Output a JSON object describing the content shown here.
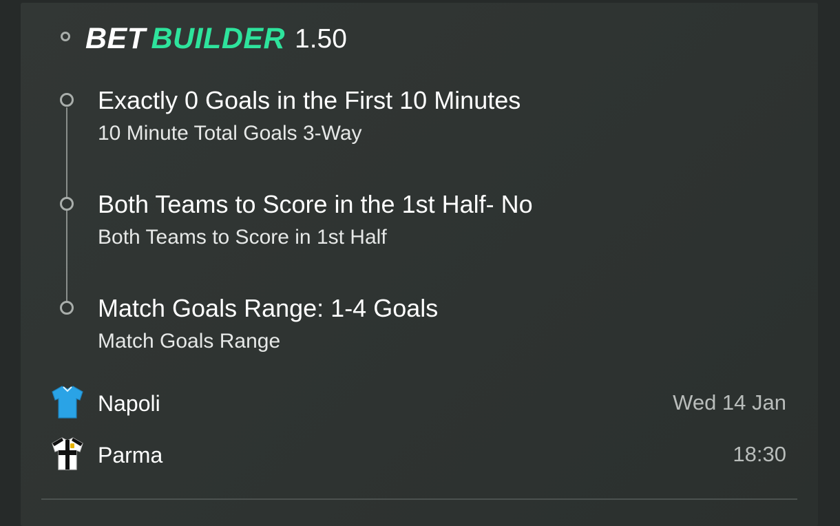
{
  "bet_builder": {
    "brand_word1": "BET",
    "brand_word2": "BUILDER",
    "odds": "1.50",
    "brand_accent_color": "#2ee39c"
  },
  "selections": [
    {
      "title": "Exactly 0 Goals in the First 10 Minutes",
      "market": "10 Minute Total Goals 3-Way"
    },
    {
      "title": "Both Teams to Score in the 1st Half- No",
      "market": "Both Teams to Score in 1st Half"
    },
    {
      "title": "Match Goals Range: 1-4 Goals",
      "market": "Match Goals Range"
    }
  ],
  "match": {
    "home": {
      "name": "Napoli",
      "kit_icon": "napoli-kit-icon",
      "kit_color": "#2aa3e6"
    },
    "away": {
      "name": "Parma",
      "kit_icon": "parma-kit-icon",
      "kit_color": "#ffffff"
    },
    "date": "Wed 14 Jan",
    "time": "18:30"
  }
}
